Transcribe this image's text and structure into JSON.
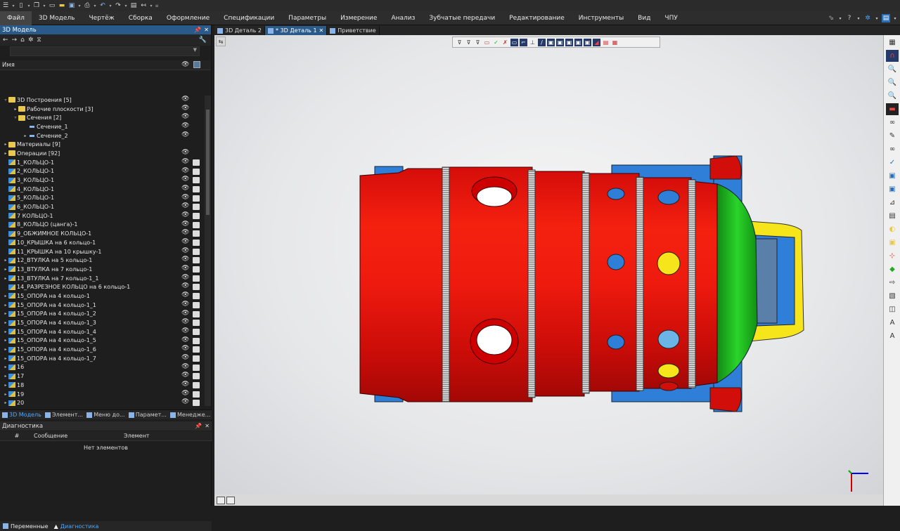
{
  "menu": [
    "Файл",
    "3D Модель",
    "Чертёж",
    "Сборка",
    "Оформление",
    "Спецификации",
    "Параметры",
    "Измерение",
    "Анализ",
    "Зубчатые передачи",
    "Редактирование",
    "Инструменты",
    "Вид",
    "ЧПУ"
  ],
  "left_panel": {
    "title": "3D Модель",
    "column_name": "Имя",
    "tree": [
      {
        "label": "3D Построения [5]",
        "indent": 0,
        "icon": "folder",
        "arrow": "▿",
        "eye": true,
        "cube": false
      },
      {
        "label": "Рабочие плоскости [3]",
        "indent": 1,
        "icon": "folder",
        "arrow": "▸",
        "eye": true,
        "cube": false
      },
      {
        "label": "Сечения [2]",
        "indent": 1,
        "icon": "folder",
        "arrow": "▿",
        "eye": true,
        "cube": false
      },
      {
        "label": "Сечение_1",
        "indent": 2,
        "icon": "sec",
        "arrow": "",
        "eye": true,
        "cube": false
      },
      {
        "label": "Сечение_2",
        "indent": 2,
        "icon": "sec",
        "arrow": "▸",
        "eye": true,
        "cube": false
      },
      {
        "label": "Материалы [9]",
        "indent": 0,
        "icon": "folder",
        "arrow": "▸",
        "eye": false,
        "cube": false
      },
      {
        "label": "Операции [92]",
        "indent": 0,
        "icon": "folder",
        "arrow": "▸",
        "eye": true,
        "cube": false
      },
      {
        "label": "1_КОЛЬЦО-1",
        "indent": 0,
        "icon": "op",
        "arrow": "",
        "eye": true,
        "cube": true
      },
      {
        "label": "2_КОЛЬЦО-1",
        "indent": 0,
        "icon": "op",
        "arrow": "",
        "eye": true,
        "cube": true
      },
      {
        "label": "3_КОЛЬЦО-1",
        "indent": 0,
        "icon": "op",
        "arrow": "",
        "eye": true,
        "cube": true
      },
      {
        "label": "4_КОЛЬЦО-1",
        "indent": 0,
        "icon": "op",
        "arrow": "",
        "eye": true,
        "cube": true
      },
      {
        "label": "5_КОЛЬЦО-1",
        "indent": 0,
        "icon": "op",
        "arrow": "",
        "eye": true,
        "cube": true
      },
      {
        "label": "6_КОЛЬЦО-1",
        "indent": 0,
        "icon": "op",
        "arrow": "",
        "eye": true,
        "cube": true
      },
      {
        "label": "7 КОЛЬЦО-1",
        "indent": 0,
        "icon": "op",
        "arrow": "",
        "eye": true,
        "cube": true
      },
      {
        "label": "8_КОЛЬЦО (цанга)-1",
        "indent": 0,
        "icon": "op",
        "arrow": "",
        "eye": true,
        "cube": true
      },
      {
        "label": "9_ОБЖИМНОЕ КОЛЬЦО-1",
        "indent": 0,
        "icon": "op",
        "arrow": "",
        "eye": true,
        "cube": true
      },
      {
        "label": "10_КРЫШКА на 6 кольцо-1",
        "indent": 0,
        "icon": "op",
        "arrow": "",
        "eye": true,
        "cube": true
      },
      {
        "label": "11_КРЫШКА на 10 крышку-1",
        "indent": 0,
        "icon": "op",
        "arrow": "",
        "eye": true,
        "cube": true
      },
      {
        "label": "12_ВТУЛКА на 5 кольцо-1",
        "indent": 0,
        "icon": "op",
        "arrow": "▸",
        "eye": true,
        "cube": true
      },
      {
        "label": "13_ВТУЛКА на 7 кольцо-1",
        "indent": 0,
        "icon": "op",
        "arrow": "▸",
        "eye": true,
        "cube": true
      },
      {
        "label": "13_ВТУЛКА на 7 кольцо-1_1",
        "indent": 0,
        "icon": "op",
        "arrow": "▸",
        "eye": true,
        "cube": true
      },
      {
        "label": "14_РАЗРЕЗНОЕ КОЛЬЦО на 6 кольцо-1",
        "indent": 0,
        "icon": "op",
        "arrow": "",
        "eye": true,
        "cube": true
      },
      {
        "label": "15_ОПОРА на 4 кольцо-1",
        "indent": 0,
        "icon": "op",
        "arrow": "▸",
        "eye": true,
        "cube": true
      },
      {
        "label": "15_ОПОРА на 4 кольцо-1_1",
        "indent": 0,
        "icon": "op",
        "arrow": "▸",
        "eye": true,
        "cube": true
      },
      {
        "label": "15_ОПОРА на 4 кольцо-1_2",
        "indent": 0,
        "icon": "op",
        "arrow": "▸",
        "eye": true,
        "cube": true
      },
      {
        "label": "15_ОПОРА на 4 кольцо-1_3",
        "indent": 0,
        "icon": "op",
        "arrow": "▸",
        "eye": true,
        "cube": true
      },
      {
        "label": "15_ОПОРА на 4 кольцо-1_4",
        "indent": 0,
        "icon": "op",
        "arrow": "▸",
        "eye": true,
        "cube": true
      },
      {
        "label": "15_ОПОРА на 4 кольцо-1_5",
        "indent": 0,
        "icon": "op",
        "arrow": "▸",
        "eye": true,
        "cube": true
      },
      {
        "label": "15_ОПОРА на 4 кольцо-1_6",
        "indent": 0,
        "icon": "op",
        "arrow": "▸",
        "eye": true,
        "cube": true
      },
      {
        "label": "15_ОПОРА на 4 кольцо-1_7",
        "indent": 0,
        "icon": "op",
        "arrow": "▸",
        "eye": true,
        "cube": true
      },
      {
        "label": "16",
        "indent": 0,
        "icon": "op",
        "arrow": "▸",
        "eye": true,
        "cube": true
      },
      {
        "label": "17",
        "indent": 0,
        "icon": "op",
        "arrow": "▸",
        "eye": true,
        "cube": true
      },
      {
        "label": "18",
        "indent": 0,
        "icon": "op",
        "arrow": "▸",
        "eye": true,
        "cube": true
      },
      {
        "label": "19",
        "indent": 0,
        "icon": "op",
        "arrow": "▸",
        "eye": true,
        "cube": true
      },
      {
        "label": "20",
        "indent": 0,
        "icon": "op",
        "arrow": "▸",
        "eye": true,
        "cube": true
      }
    ],
    "bottom_tabs": [
      "3D Модель",
      "Элемент...",
      "Меню до...",
      "Парамет...",
      "Менедже..."
    ]
  },
  "diagnostics": {
    "title": "Диагностика",
    "col_hash": "#",
    "col_message": "Сообщение",
    "col_element": "Элемент",
    "empty": "Нет элементов"
  },
  "footer_tabs": [
    "Переменные",
    "Диагностика"
  ],
  "doc_tabs": [
    "3D Деталь 2",
    "* 3D Деталь 1",
    "Приветствие"
  ],
  "colors": {
    "red": "#e8120e",
    "green": "#1fc21f",
    "blue": "#2f7fd8",
    "yellow": "#f5e51a",
    "accent": "#2a5a8a"
  }
}
